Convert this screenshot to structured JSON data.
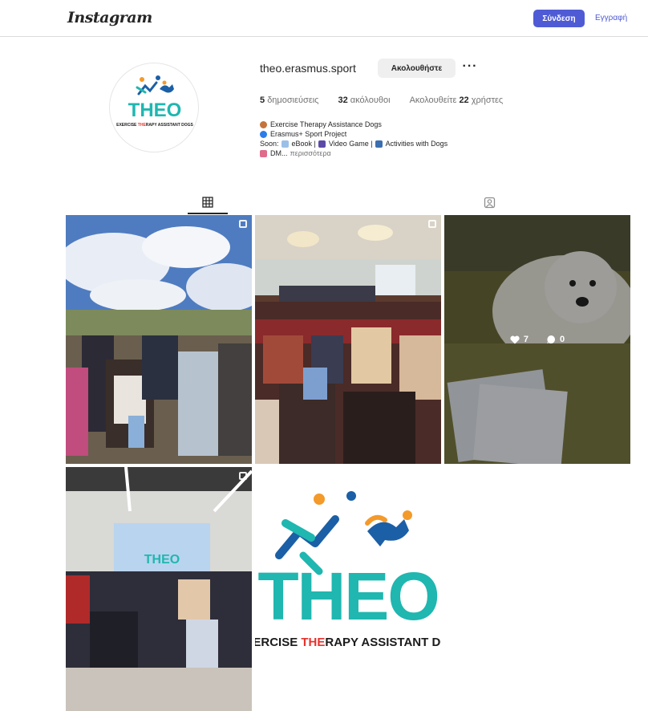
{
  "header": {
    "logo": "Instagram",
    "login_label": "Σύνδεση",
    "signup_label": "Εγγραφή"
  },
  "profile": {
    "username": "theo.erasmus.sport",
    "follow_label": "Ακολουθήστε",
    "more_label": "···",
    "stats": {
      "posts_count": "5",
      "posts_label": "δημοσιεύσεις",
      "followers_count": "32",
      "followers_label": "ακόλουθοι",
      "following_prefix": "Ακολουθείτε",
      "following_count": "22",
      "following_suffix": "χρήστες"
    },
    "bio": {
      "line1": "Exercise Therapy Assistance Dogs",
      "line2": "Erasmus+ Sport Project",
      "line3_prefix": "Soon:",
      "line3_ebook": "eBook |",
      "line3_game": "Video Game |",
      "line3_activities": "Activities with Dogs",
      "line4": "DM...",
      "more_link": "περισσότερα"
    },
    "avatar_logo": {
      "word": "THEO",
      "tagline_a": "EXERCISE ",
      "tagline_b": "THE",
      "tagline_c": "RAPY ASSISTANT DOGS"
    }
  },
  "tabs": {
    "posts_icon": "grid-icon",
    "tagged_icon": "tagged-portrait-icon"
  },
  "posts": [
    {
      "icon": "multi-post-icon"
    },
    {
      "icon": "multi-post-icon"
    },
    {
      "likes": "7",
      "comments": "0",
      "like_icon": "heart-icon",
      "comment_icon": "comment-icon"
    },
    {
      "icon": "multi-post-icon"
    },
    {
      "logo_word": "THEO",
      "tagline_a": "EXERCISE ",
      "tagline_b": "THE",
      "tagline_c": "RAPY ASSISTANT DOG"
    }
  ],
  "colors": {
    "brand_blue": "#4f5bd5",
    "theo_teal": "#1fb7b0",
    "theo_blue": "#1b5fa6",
    "theo_orange": "#f39a2b"
  }
}
